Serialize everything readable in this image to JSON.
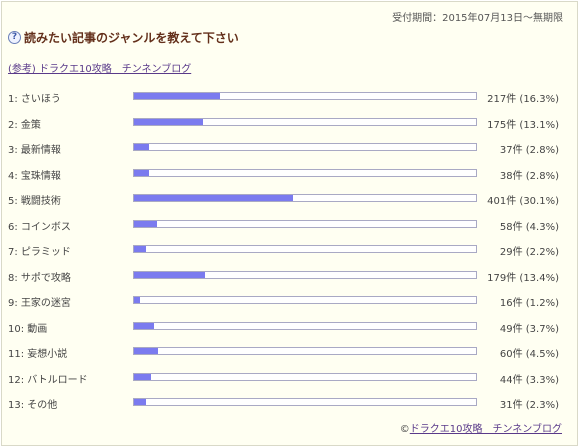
{
  "header": {
    "period": "受付期間：2015年07月13日～無期限",
    "question": "読みたい記事のジャンルを教えて下さい",
    "reference_link": "(参考) ドラクエ10攻略　チンネンブログ"
  },
  "results": [
    {
      "index": "1:",
      "label": "さいほう",
      "count": "217件 (16.3%)",
      "percent": 16.3
    },
    {
      "index": "2:",
      "label": "金策",
      "count": "175件 (13.1%)",
      "percent": 13.1
    },
    {
      "index": "3:",
      "label": "最新情報",
      "count": "37件 (2.8%)",
      "percent": 2.8
    },
    {
      "index": "4:",
      "label": "宝珠情報",
      "count": "38件 (2.8%)",
      "percent": 2.8
    },
    {
      "index": "5:",
      "label": "戦闘技術",
      "count": "401件 (30.1%)",
      "percent": 30.1
    },
    {
      "index": "6:",
      "label": "コインボス",
      "count": "58件 (4.3%)",
      "percent": 4.3
    },
    {
      "index": "7:",
      "label": "ピラミッド",
      "count": "29件 (2.2%)",
      "percent": 2.2
    },
    {
      "index": "8:",
      "label": "サポで攻略",
      "count": "179件 (13.4%)",
      "percent": 13.4
    },
    {
      "index": "9:",
      "label": "王家の迷宮",
      "count": "16件 (1.2%)",
      "percent": 1.2
    },
    {
      "index": "10:",
      "label": "動画",
      "count": "49件 (3.7%)",
      "percent": 3.7
    },
    {
      "index": "11:",
      "label": "妄想小説",
      "count": "60件 (4.5%)",
      "percent": 4.5
    },
    {
      "index": "12:",
      "label": "バトルロード",
      "count": "44件 (3.3%)",
      "percent": 3.3
    },
    {
      "index": "13:",
      "label": "その他",
      "count": "31件 (2.3%)",
      "percent": 2.3
    }
  ],
  "footer": {
    "copyright_symbol": "©",
    "link": "ドラクエ10攻略　チンネンブログ"
  },
  "colors": {
    "bar_fill": "#7b7bef",
    "background": "#fffff2",
    "title": "#632f1a"
  }
}
